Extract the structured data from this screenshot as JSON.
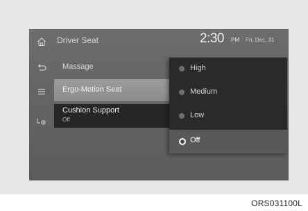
{
  "header": {
    "title": "Driver Seat",
    "time": "2:30",
    "ampm": "PM",
    "date": "Fri, Dec. 31"
  },
  "sidebar": {
    "icons": [
      "home-icon",
      "back-icon",
      "menu-icon",
      "settings-icon"
    ]
  },
  "menu": {
    "items": [
      {
        "label": "Massage"
      },
      {
        "label": "Ergo-Motion Seat"
      },
      {
        "label": "Cushion Support",
        "sub": "Off"
      }
    ]
  },
  "popup": {
    "options": [
      {
        "label": "High",
        "selected": false
      },
      {
        "label": "Medium",
        "selected": false
      },
      {
        "label": "Low",
        "selected": false
      },
      {
        "label": "Off",
        "selected": true
      }
    ]
  },
  "figure_code": "ORS031100L",
  "colors": {
    "screen_bg": "#646464",
    "popup_bg": "#2a2a2a",
    "highlight": "#8c8c8c"
  }
}
